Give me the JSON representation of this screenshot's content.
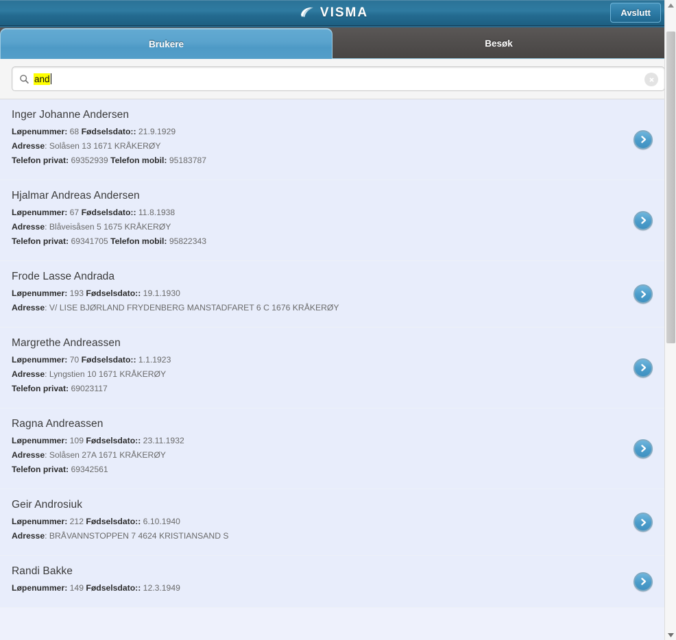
{
  "header": {
    "brand": "VISMA",
    "logo_icon": "visma-swoosh-logo",
    "exit_label": "Avslutt"
  },
  "tabs": [
    {
      "label": "Brukere",
      "active": true
    },
    {
      "label": "Besøk",
      "active": false
    }
  ],
  "search": {
    "value": "and",
    "placeholder": "",
    "icon": "search-icon",
    "clear_icon": "clear-circle-icon",
    "highlight_color": "#ffff00"
  },
  "labels": {
    "lopenummer": "Løpenummer:",
    "fodselsdato": "Fødselsdato::",
    "adresse": "Adresse:",
    "telefon_privat": "Telefon privat:",
    "telefon_mobil": "Telefon mobil:"
  },
  "colors": {
    "header_blue": "#2b7296",
    "tab_active": "#539ec9",
    "tab_inactive": "#514e4d",
    "row_bg": "#e8edfb",
    "row_border": "#b9c6e4",
    "go_button": "#4b9cca"
  },
  "users": [
    {
      "name": "Inger Johanne Andersen",
      "lopenummer": "68",
      "fodselsdato": "21.9.1929",
      "adresse": "Solåsen 13 1671 KRÅKERØY",
      "telefon_privat": "69352939",
      "telefon_mobil": "95183787"
    },
    {
      "name": "Hjalmar Andreas Andersen",
      "lopenummer": "67",
      "fodselsdato": "11.8.1938",
      "adresse": "Blåveisåsen 5 1675 KRÅKERØY",
      "telefon_privat": "69341705",
      "telefon_mobil": "95822343"
    },
    {
      "name": "Frode Lasse Andrada",
      "lopenummer": "193",
      "fodselsdato": "19.1.1930",
      "adresse": "V/ LISE BJØRLAND FRYDENBERG MANSTADFARET 6 C 1676 KRÅKERØY",
      "telefon_privat": "",
      "telefon_mobil": ""
    },
    {
      "name": "Margrethe Andreassen",
      "lopenummer": "70",
      "fodselsdato": "1.1.1923",
      "adresse": "Lyngstien 10 1671 KRÅKERØY",
      "telefon_privat": "69023117",
      "telefon_mobil": ""
    },
    {
      "name": "Ragna Andreassen",
      "lopenummer": "109",
      "fodselsdato": "23.11.1932",
      "adresse": "Solåsen 27A 1671 KRÅKERØY",
      "telefon_privat": "69342561",
      "telefon_mobil": ""
    },
    {
      "name": "Geir Androsiuk",
      "lopenummer": "212",
      "fodselsdato": "6.10.1940",
      "adresse": "BRÅVANNSTOPPEN 7 4624 KRISTIANSAND S",
      "telefon_privat": "",
      "telefon_mobil": ""
    },
    {
      "name": "Randi Bakke",
      "lopenummer": "149",
      "fodselsdato": "12.3.1949",
      "adresse": "",
      "telefon_privat": "",
      "telefon_mobil": ""
    }
  ],
  "scrollbar": {
    "up_icon": "triangle-up-icon",
    "down_icon": "triangle-down-icon",
    "thumb": "scroll-thumb"
  }
}
